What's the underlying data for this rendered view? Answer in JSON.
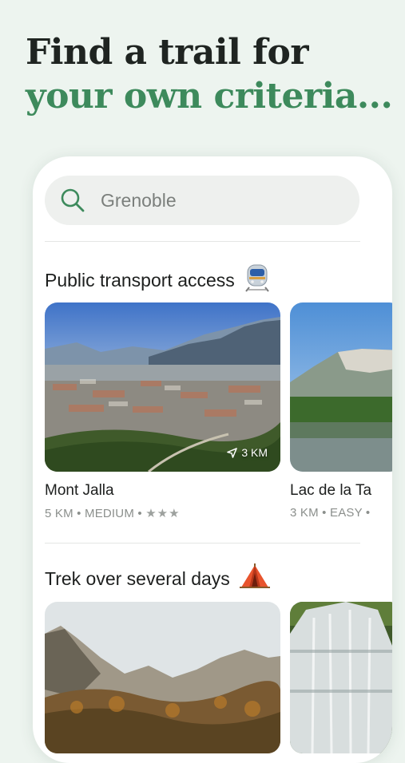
{
  "headline": {
    "line1": "Find a trail for",
    "line2": "your own criteria..."
  },
  "search": {
    "placeholder": "Grenoble"
  },
  "sections": [
    {
      "title": "Public transport access",
      "emoji": "🚆",
      "cards": [
        {
          "name": "Mont Jalla",
          "distance": "5 KM",
          "difficulty": "MEDIUM",
          "rating": "★★★",
          "away": "3 KM"
        },
        {
          "name": "Lac de la Ta",
          "distance": "3 KM",
          "difficulty": "EASY",
          "rating": ""
        }
      ]
    },
    {
      "title": "Trek over several days",
      "emoji": "⛺",
      "cards": []
    }
  ],
  "colors": {
    "accent": "#3d8a5c",
    "background": "#edf4ef",
    "text": "#1f2421"
  },
  "icons": {
    "search": "search-icon",
    "train": "train-icon",
    "tent": "tent-icon",
    "location": "location-arrow-icon"
  }
}
